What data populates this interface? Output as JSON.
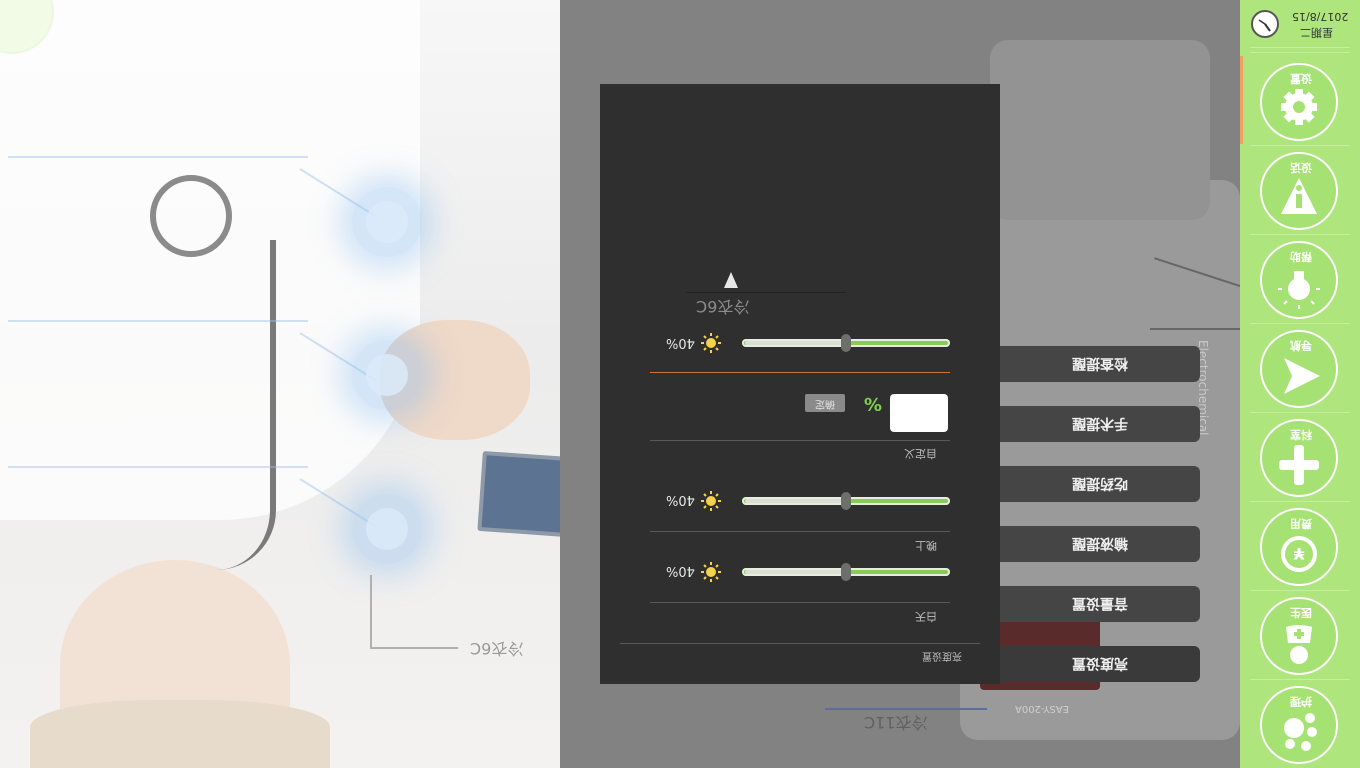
{
  "clock": {
    "date": "2017/8/15",
    "weekday": "星期二"
  },
  "sidebar": {
    "items": [
      {
        "label": "设置",
        "icon": "gear-icon"
      },
      {
        "label": "设话",
        "icon": "info-icon"
      },
      {
        "label": "帮助",
        "icon": "lightbulb-icon"
      },
      {
        "label": "导航",
        "icon": "navigation-icon"
      },
      {
        "label": "科室",
        "icon": "hospital-cross-icon"
      },
      {
        "label": "费用",
        "icon": "currency-icon"
      },
      {
        "label": "医生",
        "icon": "doctor-icon"
      },
      {
        "label": "护理",
        "icon": "nursing-icon"
      }
    ]
  },
  "menu": {
    "items": [
      "检查提醒",
      "手术提醒",
      "吃药提醒",
      "输液提醒",
      "音量设置",
      "亮度设置"
    ]
  },
  "dialog": {
    "title": "亮度设置",
    "day_label": "白天",
    "night_label": "晚上",
    "custom_label": "自定义",
    "ok_button": "确定",
    "percent_sign": "%",
    "sliders": [
      {
        "name": "day",
        "value_label": "40%",
        "level": 0.5
      },
      {
        "name": "night",
        "value_label": "40%",
        "level": 0.5
      },
      {
        "name": "custom",
        "value_label": "40%",
        "level": 0.5
      }
    ],
    "bg_text": "冷衣6C"
  },
  "left": {
    "bg_text_1": "冷衣6C",
    "bg_text_2": "冷衣11C",
    "device_text": "Electrochemical",
    "device_model": "EASY-200A"
  },
  "colors": {
    "sidebar": "#aee57d",
    "accent_green": "#8acb57",
    "dialog_bg": "#2f2f2f",
    "accent_orange": "#c9733f"
  }
}
